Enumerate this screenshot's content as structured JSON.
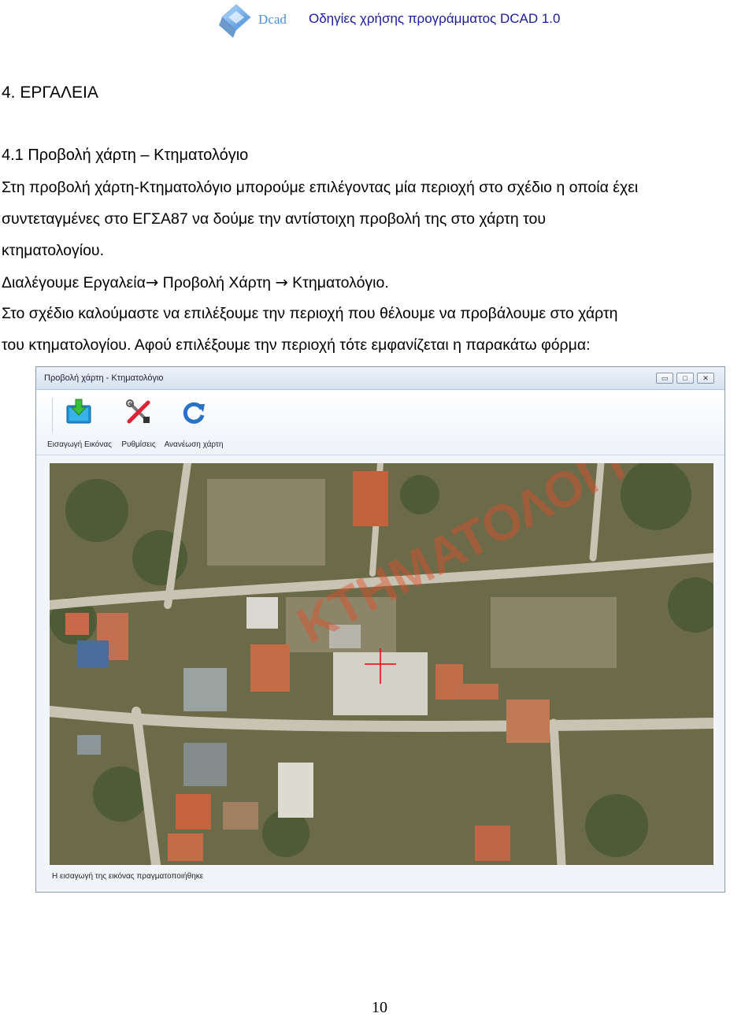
{
  "header": {
    "logo_text": "Dcad",
    "title": "Οδηγίες χρήσης προγράμματος DCAD 1.0"
  },
  "section": {
    "heading": "4. ΕΡΓΑΛΕΙΑ",
    "subheading": "4.1 Προβολή χάρτη – Κτηματολόγιο"
  },
  "paragraphs": {
    "p1_line1": "Στη προβολή χάρτη-Κτηματολόγιο μπορούμε επιλέγοντας μία περιοχή στο σχέδιο η οποία έχει",
    "p1_line2": "συντεταγμένες στο ΕΓΣΑ87 να δούμε την αντίστοιχη προβολή της στο χάρτη του",
    "p1_line3": "κτηματολογίου.",
    "p2_part1": "Διαλέγουμε  Εργαλεία",
    "p2_arrow1": "→",
    "p2_part2": " Προβολή Χάρτη ",
    "p2_arrow2": "→",
    "p2_part3": " Κτηματολόγιο.",
    "p3_line1": "Στο σχέδιο καλούμαστε να επιλέξουμε την περιοχή που θέλουμε να προβάλουμε στο χάρτη",
    "p3_line2": "του κτηματολογίου. Αφού επιλέξουμε την περιοχή τότε εμφανίζεται η παρακάτω φόρμα:"
  },
  "window": {
    "title": "Προβολή χάρτη - Κτηματολόγιο",
    "controls": {
      "minimize": "▭",
      "maximize": "□",
      "close": "✕"
    },
    "toolbar": [
      {
        "label": "Εισαγωγή Εικόνας",
        "icon": "import-image-icon"
      },
      {
        "label": "Ρυθμίσεις",
        "icon": "settings-tools-icon"
      },
      {
        "label": "Ανανέωση χάρτη",
        "icon": "refresh-icon"
      }
    ],
    "map_watermark": "ΚΤΗΜΑΤΟΛΟΓΙ",
    "status": "Η εισαγωγή της εικόνας πραγματοποιήθηκε"
  },
  "footer": {
    "page_number": "10"
  },
  "colors": {
    "header_title": "#1a1aa0",
    "logo_blue": "#4b8fd8"
  }
}
